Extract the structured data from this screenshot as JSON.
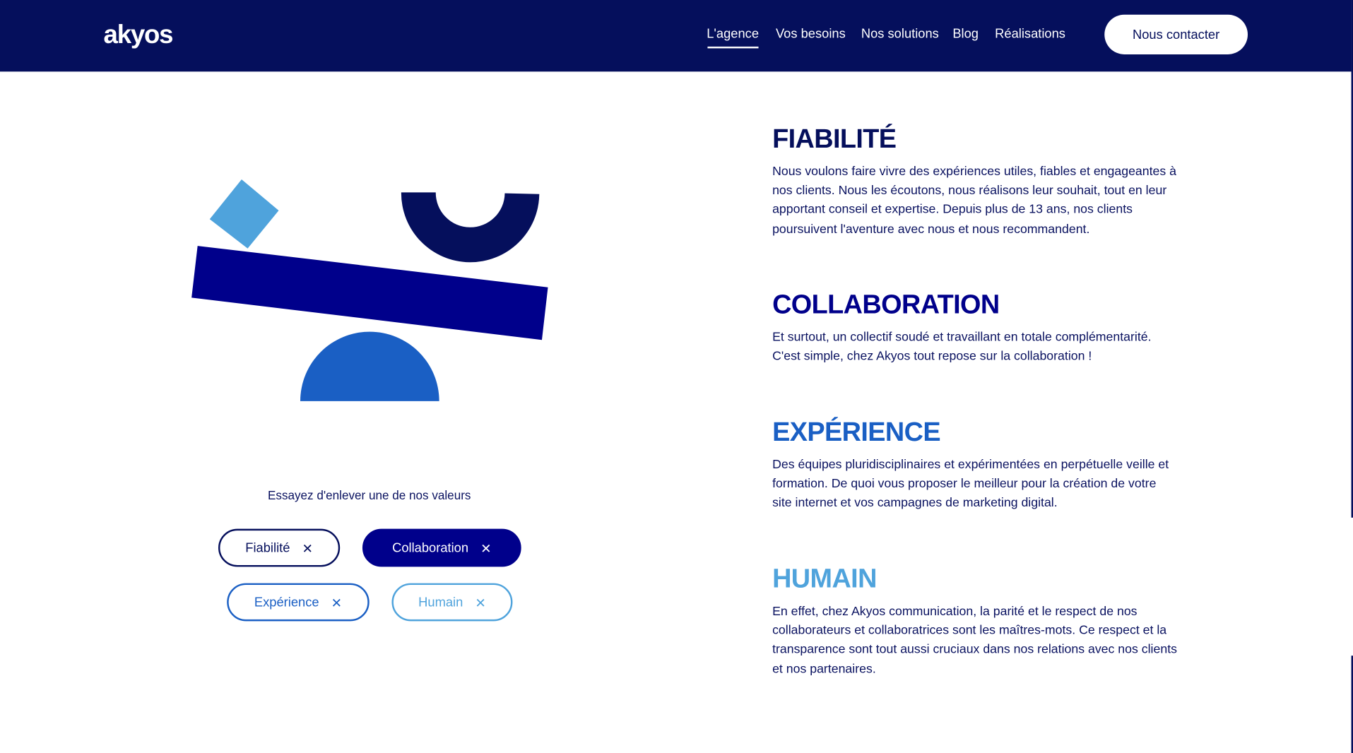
{
  "header": {
    "logo": "akyos",
    "nav": [
      "L'agence",
      "Vos besoins",
      "Nos solutions",
      "Blog",
      "Réalisations"
    ],
    "active": "L'agence",
    "cta": "Nous contacter"
  },
  "illustration": {
    "hint": "Essayez d'enlever une de nos valeurs",
    "pills": [
      {
        "label": "Fiabilité",
        "color": "#050f5c"
      },
      {
        "label": "Collaboration",
        "color": "#00008b"
      },
      {
        "label": "Expérience",
        "color": "#1a5fc4"
      },
      {
        "label": "Humain",
        "color": "#4fa3dc"
      }
    ],
    "remove_icon": "close-icon"
  },
  "values": [
    {
      "title": "FIABILITÉ",
      "color": "#050f5c",
      "text": "Nous voulons faire vivre des expériences utiles, fiables et engageantes à nos clients. Nous les écoutons, nous réalisons leur souhait, tout en leur apportant conseil et expertise. Depuis plus de 13 ans, nos clients poursuivent l'aventure avec nous et nous recommandent."
    },
    {
      "title": "COLLABORATION",
      "color": "#00008b",
      "text": "Et surtout, un collectif soudé et travaillant en totale complémentarité. C'est simple, chez Akyos tout repose sur la collaboration !"
    },
    {
      "title": "EXPÉRIENCE",
      "color": "#1a5fc4",
      "text": "Des équipes pluridisciplinaires et expérimentées en perpétuelle veille et formation. De quoi vous proposer le meilleur pour la création de votre site internet et vos campagnes de marketing digital."
    },
    {
      "title": "HUMAIN",
      "color": "#4fa3dc",
      "text": "En effet, chez Akyos communication, la parité et le respect de nos collaborateurs et collaboratrices sont les maîtres-mots. Ce respect et la transparence sont tout aussi cruciaux dans nos relations avec nos clients et nos partenaires."
    }
  ]
}
